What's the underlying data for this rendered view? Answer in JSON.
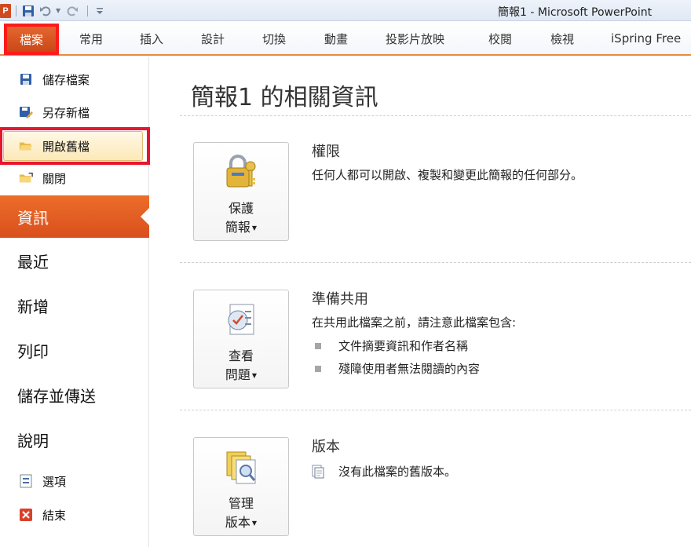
{
  "app": {
    "logo_letter": "P",
    "title": "簡報1 - Microsoft PowerPoint"
  },
  "ribbon_tabs": [
    "檔案",
    "常用",
    "插入",
    "設計",
    "切換",
    "動畫",
    "投影片放映",
    "校閱",
    "檢視",
    "iSpring Free"
  ],
  "backstage": {
    "commands": [
      {
        "label": "儲存檔案",
        "icon": "save-icon"
      },
      {
        "label": "另存新檔",
        "icon": "save-as-icon"
      },
      {
        "label": "開啟舊檔",
        "icon": "open-folder-icon"
      },
      {
        "label": "關閉",
        "icon": "close-folder-icon"
      }
    ],
    "tabs": [
      "資訊",
      "最近",
      "新增",
      "列印",
      "儲存並傳送",
      "說明"
    ],
    "bottom_commands": [
      {
        "label": "選項",
        "icon": "options-icon"
      },
      {
        "label": "結束",
        "icon": "exit-icon"
      }
    ]
  },
  "info": {
    "title": "簡報1 的相關資訊",
    "sections": [
      {
        "button_line1": "保護",
        "button_line2": "簡報",
        "button_icon": "lock-key-icon",
        "heading": "權限",
        "description": "任何人都可以開啟、複製和變更此簡報的任何部分。"
      },
      {
        "button_line1": "查看",
        "button_line2": "問題",
        "button_icon": "checklist-icon",
        "heading": "準備共用",
        "description": "在共用此檔案之前，請注意此檔案包含:",
        "bullets": [
          "文件摘要資訊和作者名稱",
          "殘障使用者無法閱讀的內容"
        ]
      },
      {
        "button_line1": "管理",
        "button_line2": "版本",
        "button_icon": "versions-icon",
        "heading": "版本",
        "version_text": "沒有此檔案的舊版本。"
      }
    ]
  },
  "colors": {
    "accent": "#e5622a",
    "highlight_border": "#e6162d"
  }
}
